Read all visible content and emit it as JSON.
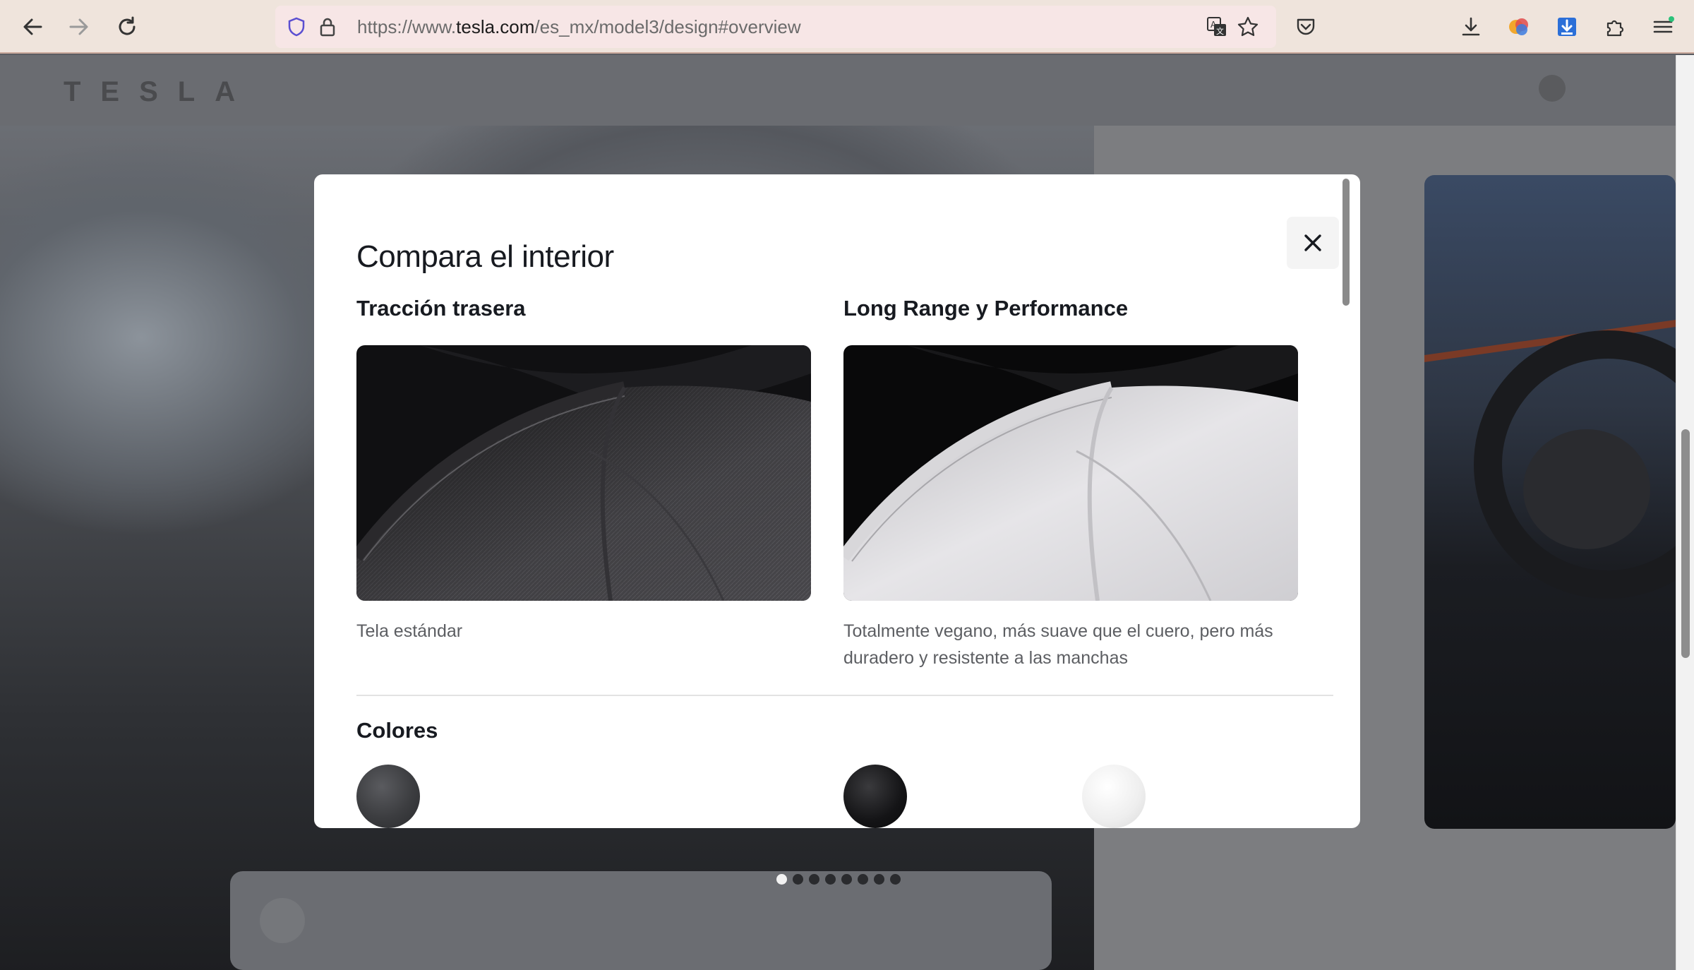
{
  "browser": {
    "url_prefix": "https://www.",
    "url_domain": "tesla.com",
    "url_path": "/es_mx/model3/design#overview"
  },
  "modal": {
    "title": "Compara el interior",
    "left": {
      "title": "Tracción trasera",
      "description": "Tela estándar"
    },
    "right": {
      "title": "Long Range y Performance",
      "description": "Totalmente vegano, más suave que el cuero, pero más duradero y resistente a las manchas"
    },
    "colors_title": "Colores",
    "swatches": [
      {
        "name": "gray-fabric",
        "color": "#3c3d40"
      },
      {
        "name": "black",
        "color": "#141416"
      },
      {
        "name": "white",
        "color": "#f2f2f2"
      }
    ]
  },
  "carousel": {
    "count": 8,
    "active": 0
  }
}
